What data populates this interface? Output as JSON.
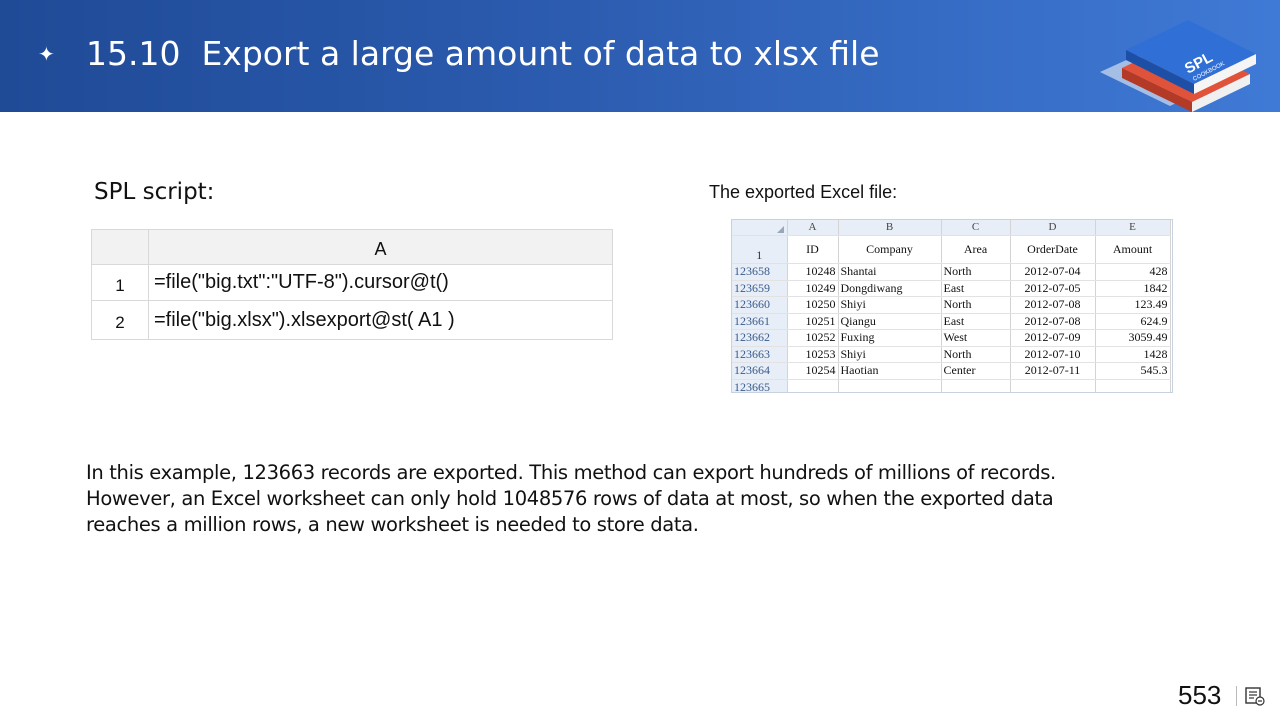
{
  "header": {
    "bullet": "✦",
    "title": "15.10  Export a large amount of data to xlsx file",
    "logo_text": [
      "SPL",
      "COOKBOOK"
    ],
    "colors": {
      "band_start": "#1f4a96",
      "band_end": "#3f7ad6",
      "book_blue": "#2f6fd6",
      "book_red": "#e0533a"
    }
  },
  "spl": {
    "label": "SPL script:",
    "column": "A",
    "rows": [
      {
        "num": "1",
        "code": "=file(\"big.txt\":\"UTF-8\").cursor@t()"
      },
      {
        "num": "2",
        "code": "=file(\"big.xlsx\").xlsexport@st( A1 )"
      }
    ]
  },
  "excel": {
    "label": "The exported Excel file:",
    "col_letters": [
      "A",
      "B",
      "C",
      "D",
      "E"
    ],
    "header_row": "1",
    "headers": [
      "ID",
      "Company",
      "Area",
      "OrderDate",
      "Amount"
    ],
    "rows": [
      {
        "rn": "123658",
        "cells": [
          "10248",
          "Shantai",
          "North",
          "2012-07-04",
          "428"
        ]
      },
      {
        "rn": "123659",
        "cells": [
          "10249",
          "Dongdiwang",
          "East",
          "2012-07-05",
          "1842"
        ]
      },
      {
        "rn": "123660",
        "cells": [
          "10250",
          "Shiyi",
          "North",
          "2012-07-08",
          "123.49"
        ]
      },
      {
        "rn": "123661",
        "cells": [
          "10251",
          "Qiangu",
          "East",
          "2012-07-08",
          "624.9"
        ]
      },
      {
        "rn": "123662",
        "cells": [
          "10252",
          "Fuxing",
          "West",
          "2012-07-09",
          "3059.49"
        ]
      },
      {
        "rn": "123663",
        "cells": [
          "10253",
          "Shiyi",
          "North",
          "2012-07-10",
          "1428"
        ]
      },
      {
        "rn": "123664",
        "cells": [
          "10254",
          "Haotian",
          "Center",
          "2012-07-11",
          "545.3"
        ]
      },
      {
        "rn": "123665",
        "cells": [
          "",
          "",
          "",
          "",
          ""
        ]
      }
    ]
  },
  "paragraph": [
    "In this example, 123663 records are exported. This method can export hundreds of millions of records.",
    "However, an Excel worksheet can only hold 1048576 rows of data at most, so when the exported data",
    "reaches a million rows, a new worksheet is needed to store data."
  ],
  "footer": {
    "page_number": "553",
    "icon": "notes-icon"
  }
}
